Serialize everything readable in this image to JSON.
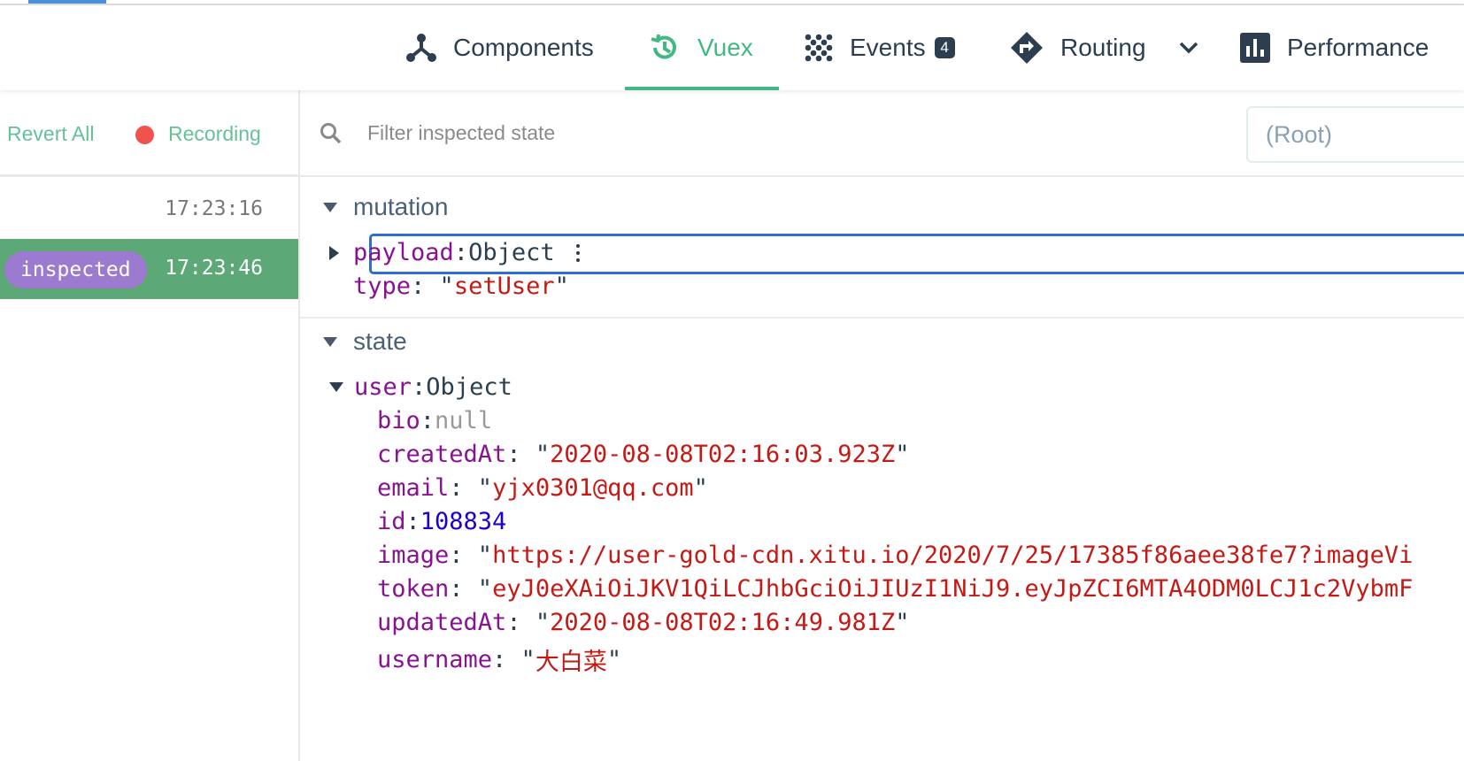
{
  "tabs": [
    {
      "label": "Components",
      "icon": "components-icon"
    },
    {
      "label": "Vuex",
      "icon": "history-icon",
      "active": true
    },
    {
      "label": "Events",
      "icon": "events-icon",
      "badge": "4"
    },
    {
      "label": "Routing",
      "icon": "routing-icon"
    },
    {
      "label": "Performance",
      "icon": "bar-chart-icon"
    }
  ],
  "toolbar": {
    "revert_all": "Revert All",
    "recording": "Recording"
  },
  "history": [
    {
      "time": "17:23:16"
    },
    {
      "time": "17:23:46",
      "tag": "inspected",
      "selected": true
    }
  ],
  "filter": {
    "placeholder": "Filter inspected state",
    "root": "(Root)"
  },
  "mutation": {
    "title": "mutation",
    "payload_key": "payload",
    "payload_value": "Object",
    "type_key": "type",
    "type_value": "setUser"
  },
  "state": {
    "title": "state",
    "user_key": "user",
    "user_value": "Object",
    "fields": [
      {
        "key": "bio",
        "value": "null",
        "kind": "null"
      },
      {
        "key": "createdAt",
        "value": "2020-08-08T02:16:03.923Z",
        "kind": "string"
      },
      {
        "key": "email",
        "value": "yjx0301@qq.com",
        "kind": "string"
      },
      {
        "key": "id",
        "value": "108834",
        "kind": "number"
      },
      {
        "key": "image",
        "value": "https://user-gold-cdn.xitu.io/2020/7/25/17385f86aee38fe7?imageVi",
        "kind": "string"
      },
      {
        "key": "token",
        "value": "eyJ0eXAiOiJKV1QiLCJhbGciOiJIUzI1NiJ9.eyJpZCI6MTA4ODM0LCJ1c2VybmF",
        "kind": "string"
      },
      {
        "key": "updatedAt",
        "value": "2020-08-08T02:16:49.981Z",
        "kind": "string"
      },
      {
        "key": "username",
        "value": "大白菜",
        "kind": "string"
      }
    ]
  },
  "colors": {
    "accent": "#42b983",
    "selected_row": "#5ca877",
    "inspected_pill": "#9c7ad0",
    "record_dot": "#f0524c",
    "focus_border": "#2f6cd6"
  }
}
